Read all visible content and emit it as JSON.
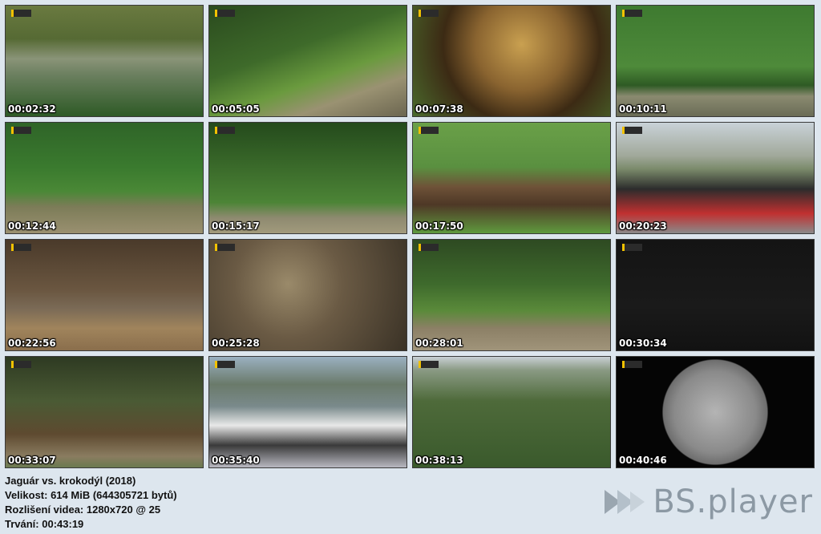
{
  "thumbnails": [
    {
      "time": "00:02:32",
      "bg": "linear-gradient(180deg,#6a7a40 0%,#566a34 30%,#8a9478 48%,#6c8060 62%,#2e5a26 100%)"
    },
    {
      "time": "00:05:05",
      "bg": "linear-gradient(160deg,#2a4a1e 0%,#3e6a2a 40%,#6a9a3e 62%,#9a9272 78%,#6c6650 100%)"
    },
    {
      "time": "00:07:38",
      "bg": "radial-gradient(circle at 55% 35%,#c9a050 0%,#8a6430 35%,#3c2a14 60%,#4a6a2c 100%)"
    },
    {
      "time": "00:10:11",
      "bg": "linear-gradient(180deg,#3e7a30 0%,#4e8a3a 55%,#2e5a24 72%,#8a8a70 82%,#6a6c56 100%)"
    },
    {
      "time": "00:12:44",
      "bg": "linear-gradient(180deg,#2f6428 0%,#3a7a2e 40%,#4a8836 62%,#7c7c58 76%,#9a9070 100%)"
    },
    {
      "time": "00:15:17",
      "bg": "linear-gradient(180deg,#244a1c 0%,#3a6a2a 40%,#4c8436 72%,#8e8a70 86%,#a29a7c 100%)"
    },
    {
      "time": "00:17:50",
      "bg": "linear-gradient(180deg,#6aa048 0%,#5a9040 40%,#6e5238 58%,#4e3826 74%,#5f9a3e 100%)"
    },
    {
      "time": "00:20:23",
      "bg": "linear-gradient(180deg,#c9d2d8 0%,#a0a89a 30%,#7a8a6a 42%,#2c2c2c 60%,#c03030 82%,#8a8a8a 100%)"
    },
    {
      "time": "00:22:56",
      "bg": "linear-gradient(180deg,#4a3a2a 0%,#6a5640 45%,#7a6a56 62%,#a0845c 80%,#8a6e4c 100%)"
    },
    {
      "time": "00:25:28",
      "bg": "radial-gradient(circle at 40% 40%,#9a8a6a 0%,#6a5a44 40%,#3a3226 100%)"
    },
    {
      "time": "00:28:01",
      "bg": "linear-gradient(180deg,#2e4a22 0%,#3e6a2c 40%,#5a8a3a 64%,#8c8066 80%,#a0947a 100%)"
    },
    {
      "time": "00:30:34",
      "bg": "linear-gradient(180deg,#141414 0%,#1a1a1a 60%,#121212 100%)"
    },
    {
      "time": "00:33:07",
      "bg": "linear-gradient(180deg,#2e3a22 0%,#4a5a34 40%,#5e4a30 70%,#8a7c60 90%,#6a7a50 100%)"
    },
    {
      "time": "00:35:40",
      "bg": "linear-gradient(180deg,#9ab0c0 0%,#6a7a6a 25%,#7a8a8c 45%,#e8e8e8 62%,#3a3a3a 80%,#b8b8c0 100%)"
    },
    {
      "time": "00:38:13",
      "bg": "linear-gradient(180deg,#c8cfd4 0%,#8a9a84 12%,#4e6a3a 40%,#3a5a2c 100%)"
    },
    {
      "time": "00:40:46",
      "bg": "radial-gradient(circle at 50% 50%,#b4b4b4 0%,#8a8a8a 36%,#6e6e6e 46%,#050505 47%,#050505 100%)"
    }
  ],
  "info": {
    "title": "Jaguár vs. krokodýl (2018)",
    "size": "Velikost: 614 MiB (644305721 bytů)",
    "resolution": "Rozlišení videa: 1280x720 @ 25",
    "duration": "Trvání: 00:43:19"
  },
  "brand": {
    "name": "BS.player",
    "icon": "bsplayer-logo-icon",
    "color": "#8c99a4"
  }
}
